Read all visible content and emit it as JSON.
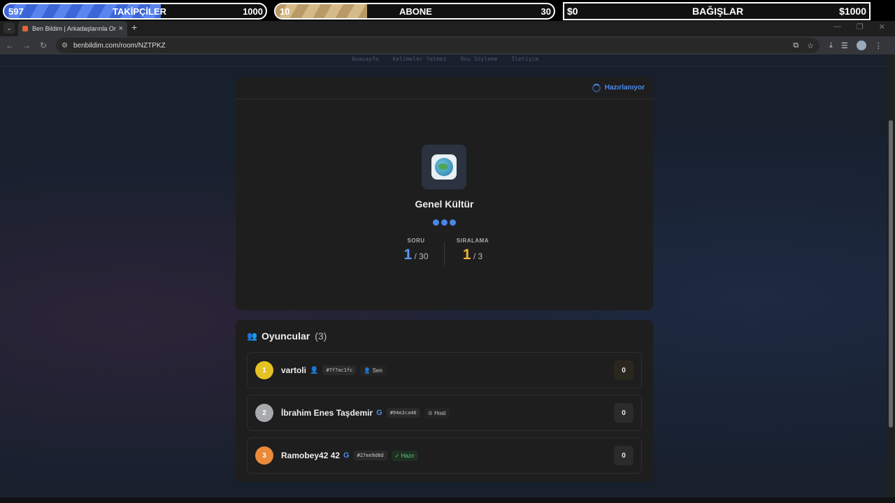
{
  "overlay": {
    "followers": {
      "current": "597",
      "label": "TAKİPÇİLER",
      "goal": "1000",
      "progress": 0.597
    },
    "subscribers": {
      "current": "10",
      "label": "ABONE",
      "goal": "30",
      "progress": 0.33
    },
    "donations": {
      "current": "$0",
      "label": "BAĞIŞLAR",
      "goal": "$1000"
    }
  },
  "browser": {
    "tab_title": "Ben Bildim | Arkadaşlarınla Onli",
    "url": "benbildim.com/room/NZTPKZ"
  },
  "nav": {
    "items": [
      "Anasayfa",
      "Kelimeler Yetmez",
      "Onu Söyleme",
      "İletişim"
    ]
  },
  "game": {
    "status": "Hazırlanıyor",
    "category": "Genel Kültür",
    "question_label": "SORU",
    "question_current": "1",
    "question_total": "/ 30",
    "rank_label": "SIRALAMA",
    "rank_current": "1",
    "rank_total": "/ 3"
  },
  "players": {
    "title": "Oyuncular",
    "count": "(3)",
    "list": [
      {
        "rank": "1",
        "name": "vartoli",
        "id": "#7f7ac1fc",
        "tag": "Sen",
        "score": "0"
      },
      {
        "rank": "2",
        "name": "İbrahim Enes Taşdemir",
        "id": "#94e2ca46",
        "tag": "Host",
        "score": "0"
      },
      {
        "rank": "3",
        "name": "Ramobey42 42",
        "id": "#27ee9d8d",
        "tag": "Hazır",
        "score": "0"
      }
    ]
  },
  "colors": {
    "accent": "#4a8cf0",
    "gold": "#f0b43a",
    "ready": "#5ecb7a"
  }
}
